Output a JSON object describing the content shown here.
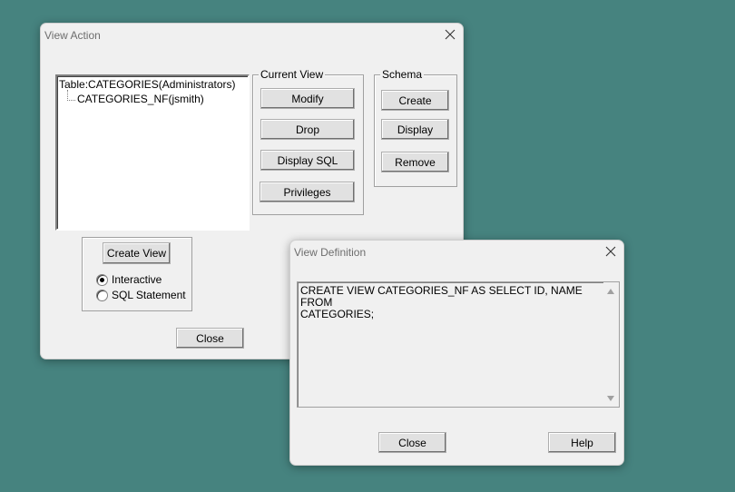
{
  "desktop": {
    "background_color": "#46837f"
  },
  "view_action": {
    "title": "View Action",
    "tree": {
      "root": "Table:CATEGORIES(Administrators)",
      "child": "CATEGORIES_NF(jsmith)"
    },
    "current_view": {
      "label": "Current View",
      "modify": "Modify",
      "drop": "Drop",
      "display_sql": "Display SQL",
      "privileges": "Privileges"
    },
    "schema": {
      "label": "Schema",
      "create": "Create",
      "display": "Display",
      "remove": "Remove"
    },
    "create_view": {
      "button": "Create View",
      "mode_interactive": "Interactive",
      "mode_sql": "SQL Statement",
      "selected": "Interactive"
    },
    "close": "Close"
  },
  "view_definition": {
    "title": "View Definition",
    "sql": "CREATE VIEW CATEGORIES_NF AS SELECT ID, NAME FROM\nCATEGORIES;",
    "close": "Close",
    "help": "Help"
  }
}
